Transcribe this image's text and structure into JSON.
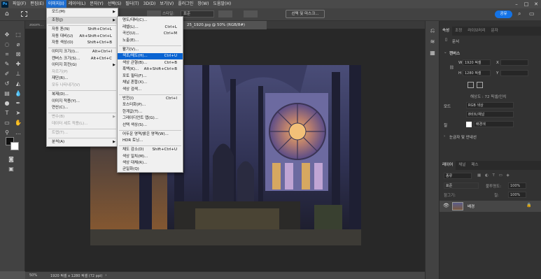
{
  "menubar": {
    "items": [
      "파일(F)",
      "편집(E)",
      "이미지(I)",
      "레이어(L)",
      "문자(Y)",
      "선택(S)",
      "필터(T)",
      "3D(D)",
      "보기(V)",
      "플러그인",
      "창(W)",
      "도움말(H)"
    ]
  },
  "optbar": {
    "mode_label": "스타일:",
    "mode_value": "표준",
    "select_mask": "선택 및 마스크...",
    "share": "공유"
  },
  "doc": {
    "tab_prev": "zoom...",
    "tab_active": "25_1920.jpg @ 50% (RGB/8#)",
    "zoom": "50%",
    "info": "1920 픽셀 x 1280 픽셀 (72 ppi)"
  },
  "image_menu": {
    "items": [
      {
        "label": "모드(M)",
        "arrow": true
      },
      {
        "label": "조정(J)",
        "arrow": true
      },
      {
        "label": "자동 톤(N)",
        "shortcut": "Shift+Ctrl+L"
      },
      {
        "label": "자동 대비(U)",
        "shortcut": "Alt+Shift+Ctrl+L"
      },
      {
        "label": "자동 색상(O)",
        "shortcut": "Shift+Ctrl+B"
      },
      {
        "label": "이미지 크기(I)...",
        "shortcut": "Alt+Ctrl+I"
      },
      {
        "label": "캔버스 크기(S)...",
        "shortcut": "Alt+Ctrl+C"
      },
      {
        "label": "이미지 회전(G)",
        "arrow": true
      },
      {
        "label": "자르기(P)"
      },
      {
        "label": "재단(R)..."
      },
      {
        "label": "모두 나타내기(V)"
      },
      {
        "label": "복제(D)..."
      },
      {
        "label": "이미지 적용(Y)..."
      },
      {
        "label": "연산(C)..."
      },
      {
        "label": "변수(B)",
        "arrow": true
      },
      {
        "label": "데이터 세트 적용(L)..."
      },
      {
        "label": "트랩(T)..."
      },
      {
        "label": "분석(A)",
        "arrow": true
      }
    ]
  },
  "adjust_menu": {
    "items": [
      {
        "label": "명도/대비(C)..."
      },
      {
        "label": "레벨(L)...",
        "shortcut": "Ctrl+L"
      },
      {
        "label": "곡선(U)...",
        "shortcut": "Ctrl+M"
      },
      {
        "label": "노출(E)..."
      },
      {
        "label": "활기(V)..."
      },
      {
        "label": "색조/채도(H)...",
        "shortcut": "Ctrl+U"
      },
      {
        "label": "색상 균형(B)...",
        "shortcut": "Ctrl+B"
      },
      {
        "label": "흑백(K)...",
        "shortcut": "Alt+Shift+Ctrl+B"
      },
      {
        "label": "포토 필터(F)..."
      },
      {
        "label": "채널 혼합(X)..."
      },
      {
        "label": "색상 검색..."
      },
      {
        "label": "반전(I)",
        "shortcut": "Ctrl+I"
      },
      {
        "label": "포스터화(P)..."
      },
      {
        "label": "한계값(T)..."
      },
      {
        "label": "그레이디언트 맵(G)..."
      },
      {
        "label": "선택 색상(S)..."
      },
      {
        "label": "어두운 영역/밝은 영역(W)..."
      },
      {
        "label": "HDR 토닝..."
      },
      {
        "label": "채도 감소(D)",
        "shortcut": "Shift+Ctrl+U"
      },
      {
        "label": "색상 일치(M)..."
      },
      {
        "label": "색상 대체(R)..."
      },
      {
        "label": "균일화(Q)"
      }
    ]
  },
  "properties": {
    "tabs": [
      "속성",
      "조정",
      "라이브러리",
      "문자"
    ],
    "doc_label": "문서",
    "canvas_header": "캔버스",
    "w_label": "W",
    "w_value": "1920 픽셀",
    "h_label": "H",
    "h_value": "1280 픽셀",
    "x_label": "X",
    "y_label": "Y",
    "resolution": "해상도 : 72 픽셀/인치",
    "mode_label": "모드",
    "mode_value": "RGB 색상",
    "depth_value": "8비트/채널",
    "fill_label": "칠",
    "fill_value": "배경색",
    "rulers_header": "눈금자 및 안내선"
  },
  "layers": {
    "tabs": [
      "레이어",
      "채널",
      "패스"
    ],
    "kind": "종류",
    "blend": "표준",
    "opacity_label": "불투명도:",
    "opacity_value": "100%",
    "lock_label": "잠그기:",
    "fill_label": "칠:",
    "fill_value": "100%",
    "layer_name": "배경"
  },
  "colors": {
    "accent": "#0a64d2",
    "share": "#1473e6"
  }
}
